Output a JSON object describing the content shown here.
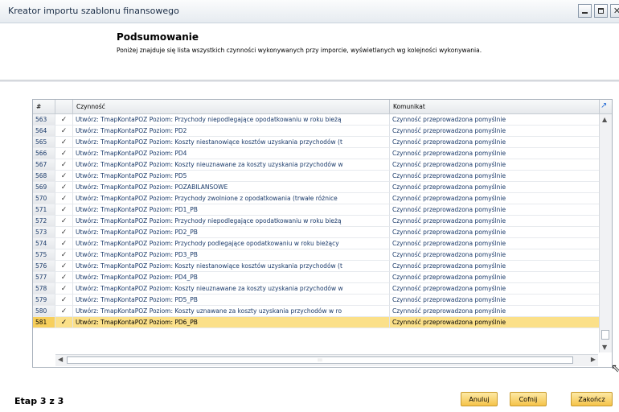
{
  "window": {
    "title": "Kreator importu szablonu finansowego",
    "close_glyph": "✕"
  },
  "header": {
    "title": "Podsumowanie",
    "description": "Poniżej znajduje się lista wszystkich czynności wykonywanych przy imporcie, wyświetlanych wg kolejności wykonywania."
  },
  "grid": {
    "columns": {
      "num": "#",
      "action": "Czynność",
      "message": "Komunikat"
    },
    "check_glyph": "✓",
    "rows": [
      {
        "num": "563",
        "action": "Utwórz: TmapKontaPOZ Poziom: Przychody niepodlegające opodatkowaniu w roku bieżą",
        "message": "Czynność przeprowadzona pomyślnie"
      },
      {
        "num": "564",
        "action": "Utwórz: TmapKontaPOZ Poziom: PD2",
        "message": "Czynność przeprowadzona pomyślnie"
      },
      {
        "num": "565",
        "action": "Utwórz: TmapKontaPOZ Poziom: Koszty niestanowiące kosztów uzyskania przychodów (t",
        "message": "Czynność przeprowadzona pomyślnie"
      },
      {
        "num": "566",
        "action": "Utwórz: TmapKontaPOZ Poziom: PD4",
        "message": "Czynność przeprowadzona pomyślnie"
      },
      {
        "num": "567",
        "action": "Utwórz: TmapKontaPOZ Poziom: Koszty nieuznawane za koszty uzyskania przychodów w",
        "message": "Czynność przeprowadzona pomyślnie"
      },
      {
        "num": "568",
        "action": "Utwórz: TmapKontaPOZ Poziom: PD5",
        "message": "Czynność przeprowadzona pomyślnie"
      },
      {
        "num": "569",
        "action": "Utwórz: TmapKontaPOZ Poziom: POZABILANSOWE",
        "message": "Czynność przeprowadzona pomyślnie"
      },
      {
        "num": "570",
        "action": "Utwórz: TmapKontaPOZ Poziom: Przychody zwolnione z opodatkowania (trwałe różnice",
        "message": "Czynność przeprowadzona pomyślnie"
      },
      {
        "num": "571",
        "action": "Utwórz: TmapKontaPOZ Poziom: PD1_PB",
        "message": "Czynność przeprowadzona pomyślnie"
      },
      {
        "num": "572",
        "action": "Utwórz: TmapKontaPOZ Poziom: Przychody niepodlegające opodatkowaniu w roku bieżą",
        "message": "Czynność przeprowadzona pomyślnie"
      },
      {
        "num": "573",
        "action": "Utwórz: TmapKontaPOZ Poziom: PD2_PB",
        "message": "Czynność przeprowadzona pomyślnie"
      },
      {
        "num": "574",
        "action": "Utwórz: TmapKontaPOZ Poziom: Przychody podlegające opodatkowaniu w roku bieżący",
        "message": "Czynność przeprowadzona pomyślnie"
      },
      {
        "num": "575",
        "action": "Utwórz: TmapKontaPOZ Poziom: PD3_PB",
        "message": "Czynność przeprowadzona pomyślnie"
      },
      {
        "num": "576",
        "action": "Utwórz: TmapKontaPOZ Poziom: Koszty niestanowiące kosztów uzyskania przychodów (t",
        "message": "Czynność przeprowadzona pomyślnie"
      },
      {
        "num": "577",
        "action": "Utwórz: TmapKontaPOZ Poziom: PD4_PB",
        "message": "Czynność przeprowadzona pomyślnie"
      },
      {
        "num": "578",
        "action": "Utwórz: TmapKontaPOZ Poziom: Koszty nieuznawane za koszty uzyskania przychodów w",
        "message": "Czynność przeprowadzona pomyślnie"
      },
      {
        "num": "579",
        "action": "Utwórz: TmapKontaPOZ Poziom: PD5_PB",
        "message": "Czynność przeprowadzona pomyślnie"
      },
      {
        "num": "580",
        "action": "Utwórz: TmapKontaPOZ Poziom: Koszty uznawane za koszty uzyskania przychodów w ro",
        "message": "Czynność przeprowadzona pomyślnie"
      },
      {
        "num": "581",
        "action": "Utwórz: TmapKontaPOZ Poziom: PD6_PB",
        "message": "Czynność przeprowadzona pomyślnie"
      }
    ],
    "selected_row": "581"
  },
  "footer": {
    "step": "Etap 3 z 3",
    "cancel_label": "Anuluj",
    "back_label": "Cofnij",
    "finish_label": "Zakończ"
  },
  "colors": {
    "selected_row": "#fbe089",
    "button": "#f5c34a",
    "accent": "#2a6fd6"
  }
}
